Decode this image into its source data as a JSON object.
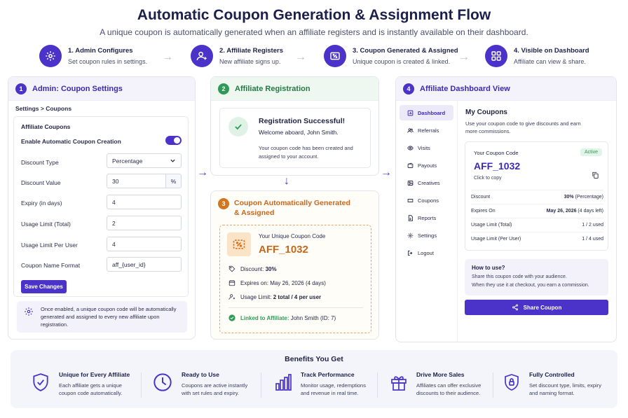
{
  "header": {
    "title": "Automatic Coupon Generation & Assignment Flow",
    "subtitle": "A unique coupon is automatically generated when an affiliate registers and is instantly available on their dashboard."
  },
  "steps": [
    {
      "title": "1. Admin Configures",
      "desc": "Set coupon rules in settings.",
      "icon": "gear-icon"
    },
    {
      "title": "2. Affiliate Registers",
      "desc": "New affiliate signs up.",
      "icon": "user-plus-icon"
    },
    {
      "title": "3. Coupon Generated & Assigned",
      "desc": "Unique coupon is created & linked.",
      "icon": "coupon-icon"
    },
    {
      "title": "4. Visible on Dashboard",
      "desc": "Affiliate can view & share.",
      "icon": "grid-icon"
    }
  ],
  "admin": {
    "num": "1",
    "title": "Admin: Coupon Settings",
    "breadcrumb": "Settings > Coupons",
    "section": "Affiliate Coupons",
    "enable_label": "Enable Automatic Coupon Creation",
    "enable_on": true,
    "fields": {
      "discount_type": {
        "label": "Discount Type",
        "value": "Percentage"
      },
      "discount_value": {
        "label": "Discount Value",
        "value": "30",
        "unit": "%"
      },
      "expiry": {
        "label": "Expiry (in days)",
        "value": "4"
      },
      "usage_total": {
        "label": "Usage Limit (Total)",
        "value": "2"
      },
      "usage_user": {
        "label": "Usage Limit Per User",
        "value": "4"
      },
      "name_format": {
        "label": "Coupon Name Format",
        "value": "aff_{user_id}"
      }
    },
    "save_label": "Save Changes",
    "note": "Once enabled, a unique coupon code will be automatically generated and assigned to every new affiliate upon registration."
  },
  "registration": {
    "num": "2",
    "title": "Affiliate Registration",
    "success_title": "Registration Successful!",
    "welcome": "Welcome aboard, John Smith.",
    "message": "Your coupon code has been created and assigned to your account."
  },
  "generated": {
    "num": "3",
    "title_line1": "Coupon Automatically Generated",
    "title_line2": "& Assigned",
    "caption": "Your Unique Coupon Code",
    "code": "AFF_1032",
    "discount_label": "Discount:",
    "discount_value": "30%",
    "expires_label": "Expires on:",
    "expires_value": "May 26, 2026 (4 days)",
    "usage_label": "Usage Limit:",
    "usage_value": "2 total / 4 per user",
    "linked_label": "Linked to Affiliate:",
    "linked_value": "John Smith (ID: 7)"
  },
  "dashboard": {
    "num": "4",
    "title": "Affiliate Dashboard View",
    "nav": [
      {
        "label": "Dashboard",
        "icon": "dashboard-icon",
        "active": true
      },
      {
        "label": "Referrals",
        "icon": "users-icon",
        "active": false
      },
      {
        "label": "Visits",
        "icon": "eye-icon",
        "active": false
      },
      {
        "label": "Payouts",
        "icon": "wallet-icon",
        "active": false
      },
      {
        "label": "Creatives",
        "icon": "image-icon",
        "active": false
      },
      {
        "label": "Coupons",
        "icon": "ticket-icon",
        "active": false
      },
      {
        "label": "Reports",
        "icon": "report-icon",
        "active": false
      },
      {
        "label": "Settings",
        "icon": "gear-icon",
        "active": false
      },
      {
        "label": "Logout",
        "icon": "logout-icon",
        "active": false
      }
    ],
    "heading": "My Coupons",
    "desc": "Use your coupon code to give discounts and earn more commissions.",
    "card_label": "Your Coupon Code",
    "status": "Active",
    "code": "AFF_1032",
    "copy_hint": "Click to copy",
    "rows": [
      {
        "k": "Discount",
        "v_bold": "30%",
        "v_rest": " (Percentage)"
      },
      {
        "k": "Expires On",
        "v_bold": "May 26, 2026",
        "v_rest": " (4 days left)"
      },
      {
        "k": "Usage Limit (Total)",
        "v_bold": "",
        "v_rest": "1 / 2 used"
      },
      {
        "k": "Usage Limit (Per User)",
        "v_bold": "",
        "v_rest": "1 / 4 used"
      }
    ],
    "howto_title": "How to use?",
    "howto_line1": "Share this coupon code with your audience.",
    "howto_line2": "When they use it at checkout, you earn a commission.",
    "share_label": "Share Coupon"
  },
  "benefits": {
    "title": "Benefits You Get",
    "items": [
      {
        "title": "Unique for Every Affiliate",
        "line1": "Each affiliate gets a unique",
        "line2": "coupon code automatically.",
        "icon": "shield-check-icon"
      },
      {
        "title": "Ready to Use",
        "line1": "Coupons are active instantly",
        "line2": "with set rules and expiry.",
        "icon": "clock-icon"
      },
      {
        "title": "Track Performance",
        "line1": "Monitor usage, redemptions",
        "line2": "and revenue in real time.",
        "icon": "bar-chart-icon"
      },
      {
        "title": "Drive More Sales",
        "line1": "Affiliates can offer exclusive",
        "line2": "discounts to their audience.",
        "icon": "gift-icon"
      },
      {
        "title": "Fully Controlled",
        "line1": "Set discount type, limits, expiry",
        "line2": "and naming format.",
        "icon": "shield-lock-icon"
      }
    ]
  },
  "colors": {
    "accent": "#4b33c9",
    "green": "#2e9a55",
    "orange": "#d4751e"
  }
}
